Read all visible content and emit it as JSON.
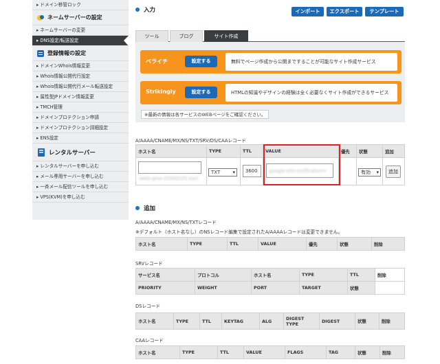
{
  "sidebar": {
    "top_item": "ドメイン移管ロック",
    "sections": [
      {
        "title": "ネームサーバーの設定",
        "items": [
          "ネームサーバーの変更",
          "DNS設定/転送設定"
        ]
      },
      {
        "title": "登録情報の設定",
        "items": [
          "ドメインWhois情報変更",
          "Whois情報公開代行設定",
          "Whois情報公開代行メール転送設定",
          "属性型JPドメイン情報変更",
          "TMCH管理",
          "ドメインプロテクション申請",
          "ドメインプロテクション詳細設定",
          "ENS設定"
        ]
      },
      {
        "title": "レンタルサーバー",
        "items": [
          "レンタルサーバーを申し込む",
          "メール専用サーバーを申し込む",
          "一斉メール配信ツールを申し込む",
          "VPS(KVM)を申し込む"
        ]
      }
    ],
    "active_item": "DNS設定/転送設定"
  },
  "input_section": {
    "title": "入力",
    "import_button": "インポート",
    "export_button": "エクスポート",
    "template_button": "テンプレート",
    "tabs": [
      "ツール",
      "ブログ",
      "サイト作成"
    ],
    "active_tab": "サイト作成",
    "services": [
      {
        "name": "ペライチ",
        "button": "設定する",
        "description": "無料でページ作成から公開まですることが可能なサイト作成サービス"
      },
      {
        "name": "Strikingly",
        "button": "設定する",
        "description": "HTMLの知識やデザインの経験は全く必要なくサイト作成ができるサービス"
      }
    ],
    "note": "※最新の情報は各サービスのWEBページをご確認ください。"
  },
  "record_form": {
    "caption": "A/AAAA/CNAME/MX/NS/TXT/SRV/DS/CAAレコード",
    "headers": [
      "ホスト名",
      "TYPE",
      "TTL",
      "VALUE",
      "優先",
      "状態",
      "追加"
    ],
    "hostname_hint": "(web-gmo-20200225.xyz)",
    "type_value": "TXT",
    "ttl_value": "3600",
    "value_text": "google-site-verification=",
    "status_value": "有効",
    "add_button": "追加"
  },
  "add_section": {
    "title": "追加",
    "a_caption": "A/AAAA/CNAME/MX/NS/TXTレコード",
    "a_note": "※デフォルト（ホスト名なし）のNSレコード編集で設定されたA/AAAAレコードは変更できません。",
    "a_headers": [
      "ホスト名",
      "TYPE",
      "TTL",
      "VALUE",
      "優先",
      "状態",
      "削除"
    ],
    "srv_caption": "SRVレコード",
    "srv_headers_row1": [
      "サービス名",
      "プロトコル",
      "ホスト名",
      "TYPE",
      "TTL",
      "削除"
    ],
    "srv_headers_row2": [
      "PRIORITY",
      "WEIGHT",
      "PORT",
      "TARGET",
      "状態"
    ],
    "ds_caption": "DSレコード",
    "ds_headers": [
      "ホスト名",
      "TYPE",
      "TTL",
      "KEYTAG",
      "ALG",
      "DIGEST TYPE",
      "DIGEST",
      "状態",
      "削除"
    ],
    "caa_caption": "CAAレコード",
    "caa_headers": [
      "ホスト名",
      "TYPE",
      "TTL",
      "VALUE",
      "FLAGS",
      "TAG",
      "状態",
      "削除"
    ]
  },
  "colors": {
    "accent": "#1c69b8",
    "orange": "#f7941d",
    "highlight": "#e02020",
    "sidebar_active": "#3a3d40"
  }
}
